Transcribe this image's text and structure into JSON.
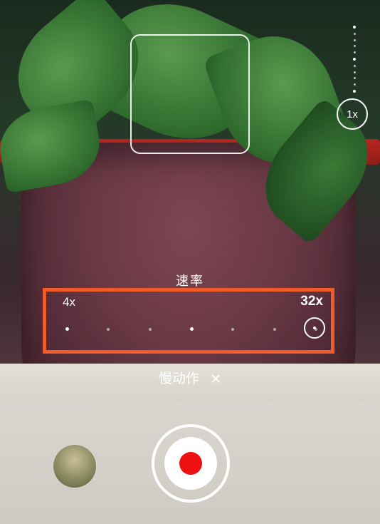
{
  "zoom": {
    "current_label": "1x"
  },
  "rate": {
    "title": "速率",
    "min_label": "4x",
    "max_label": "32x",
    "tick_count": 7,
    "selected_index": 6
  },
  "mode": {
    "label": "慢动作",
    "close_glyph": "✕"
  }
}
